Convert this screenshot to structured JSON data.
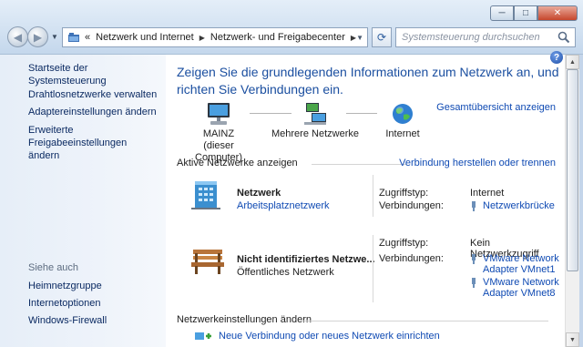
{
  "address_bar": {
    "prefix": "«",
    "crumbs": [
      "Netzwerk und Internet",
      "Netzwerk- und Freigabecenter"
    ]
  },
  "search": {
    "placeholder": "Systemsteuerung durchsuchen"
  },
  "window_controls": {
    "minimize": "─",
    "maximize": "□",
    "close": "✕"
  },
  "sidebar": {
    "home": "Startseite der Systemsteuerung",
    "links": [
      "Drahtlosnetzwerke verwalten",
      "Adaptereinstellungen ändern",
      "Erweiterte Freigabeeinstellungen ändern"
    ],
    "see_also_heading": "Siehe auch",
    "see_also": [
      "Heimnetzgruppe",
      "Internetoptionen",
      "Windows-Firewall"
    ]
  },
  "main": {
    "title": "Zeigen Sie die grundlegenden Informationen zum Netzwerk an, und richten Sie Verbindungen ein.",
    "overview_link": "Gesamtübersicht anzeigen",
    "map": {
      "computer_name": "MAINZ",
      "computer_sub": "(dieser Computer)",
      "middle": "Mehrere Netzwerke",
      "internet": "Internet"
    },
    "active_header": "Aktive Netzwerke anzeigen",
    "connect_link": "Verbindung herstellen oder trennen",
    "networks": [
      {
        "name": "Netzwerk",
        "type": "Arbeitsplatznetzwerk",
        "access_label": "Zugriffstyp:",
        "access_value": "Internet",
        "conn_label": "Verbindungen:",
        "connections": [
          "Netzwerkbrücke"
        ]
      },
      {
        "name": "Nicht identifiziertes Netzwe...",
        "type": "Öffentliches Netzwerk",
        "access_label": "Zugriffstyp:",
        "access_value": "Kein Netzwerkzugriff",
        "conn_label": "Verbindungen:",
        "connections": [
          "VMware Network Adapter VMnet1",
          "VMware Network Adapter VMnet8"
        ]
      }
    ],
    "settings_header": "Netzwerkeinstellungen ändern",
    "task_link": "Neue Verbindung oder neues Netzwerk einrichten"
  },
  "colors": {
    "link": "#0f4ab3",
    "title": "#1b4fa0",
    "sidebar_link": "#0b2a62"
  },
  "icons": [
    "back-arrow-icon",
    "forward-arrow-icon",
    "folder-icon",
    "refresh-icon",
    "search-icon",
    "help-icon",
    "computer-icon",
    "network-icon",
    "globe-icon",
    "building-icon",
    "bench-icon",
    "plug-icon",
    "new-connection-icon"
  ]
}
